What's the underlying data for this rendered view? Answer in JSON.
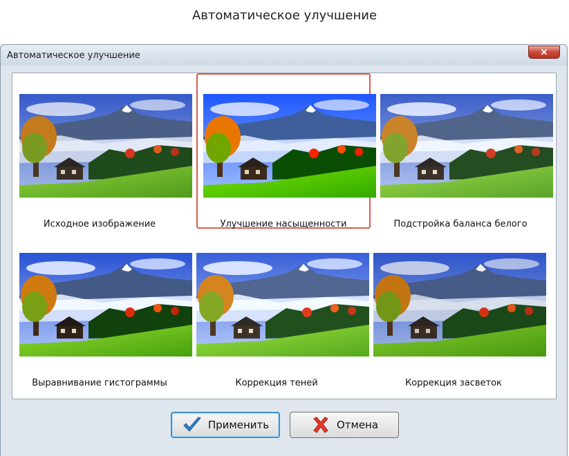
{
  "page_caption": "Автоматическое улучшение",
  "dialog": {
    "title": "Автоматическое улучшение",
    "close_glyph": "✕"
  },
  "variants": [
    {
      "label": "Исходное изображение",
      "selected": false,
      "filter": "none"
    },
    {
      "label": "Улучшение насыщенности",
      "selected": true,
      "filter": "saturate(1.5) contrast(1.05)"
    },
    {
      "label": "Подстройка баланса белого",
      "selected": false,
      "filter": "saturate(0.9) brightness(1.06)"
    },
    {
      "label": "Выравнивание гистограммы",
      "selected": false,
      "filter": "contrast(1.15)"
    },
    {
      "label": "Коррекция теней",
      "selected": false,
      "filter": "brightness(1.08)"
    },
    {
      "label": "Коррекция засветок",
      "selected": false,
      "filter": "saturate(1.1) brightness(0.96)"
    }
  ],
  "buttons": {
    "apply_label": "Применить",
    "apply_icon": "checkmark-icon",
    "cancel_label": "Отмена",
    "cancel_icon": "cross-icon"
  },
  "colors": {
    "selection_border": "#e0584f",
    "default_button_border": "#3c91d0"
  }
}
